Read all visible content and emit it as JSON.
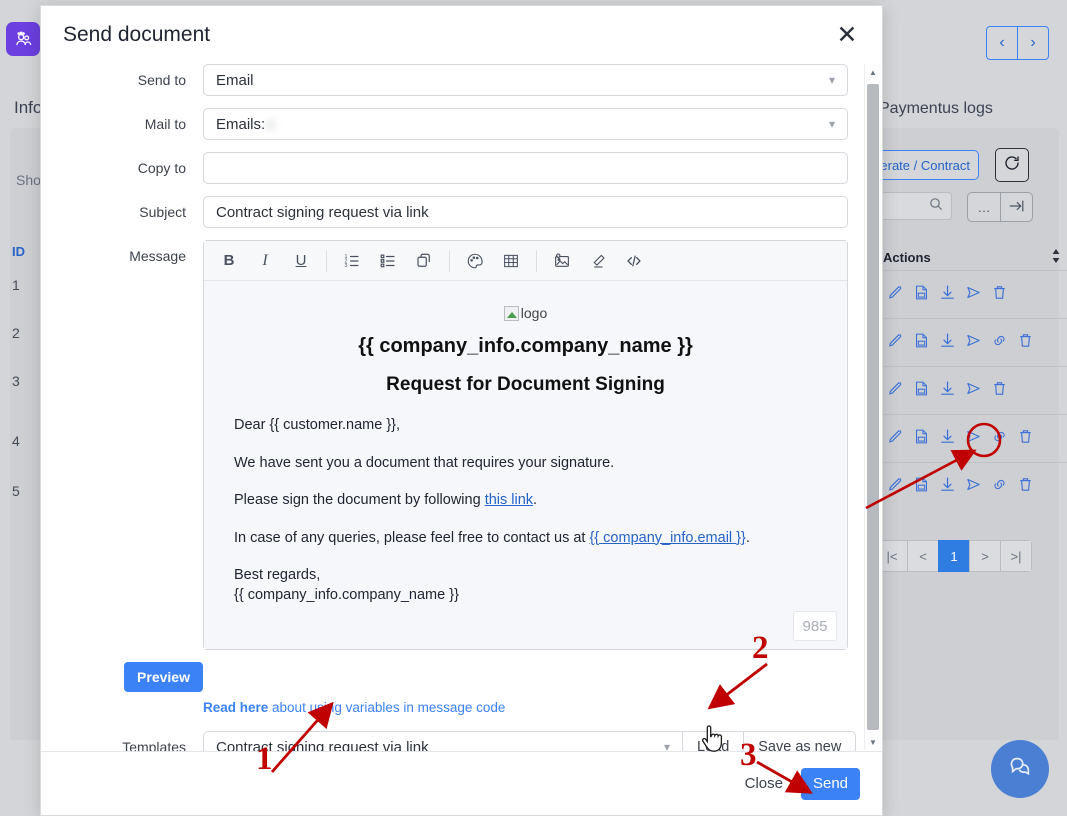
{
  "background": {
    "app_title": "Info",
    "panel_showing": "Sho",
    "id_column": "ID",
    "id_values": [
      "1",
      "2",
      "3",
      "4",
      "5"
    ],
    "right_panel_title": "Paymentus logs",
    "generate_button": "erate / Contract",
    "refresh_icon": "refresh-icon",
    "search_icon": "search-icon",
    "more_icon": "ellipsis-icon",
    "expand_icon": "expand-right-icon",
    "actions_column": "Actions",
    "sort_icon": "sort-icon",
    "row_actions": [
      [
        "edit-icon",
        "pdf-icon",
        "download-icon",
        "send-icon",
        "delete-icon"
      ],
      [
        "edit-icon",
        "pdf-icon",
        "download-icon",
        "send-icon",
        "link-icon",
        "delete-icon"
      ],
      [
        "edit-icon",
        "pdf-icon",
        "download-icon",
        "send-icon",
        "delete-icon"
      ],
      [
        "edit-icon",
        "pdf-icon",
        "download-icon",
        "send-icon",
        "link-icon",
        "delete-icon"
      ],
      [
        "edit-icon",
        "pdf-icon",
        "download-icon",
        "send-icon",
        "link-icon",
        "delete-icon"
      ]
    ],
    "pagination": {
      "first": "|<",
      "prev": "<",
      "current_page": "1",
      "next": ">",
      "last": ">|"
    },
    "topnav": {
      "prev": "‹",
      "next": "›"
    },
    "chat_icon": "chat-bubble-icon",
    "accent_blue": "#3b82f6",
    "brand_purple": "#6c3fe0"
  },
  "modal": {
    "title": "Send document",
    "close_label": "✕",
    "fields": {
      "send_to_label": "Send to",
      "send_to_value": "Email",
      "mail_to_label": "Mail to",
      "mail_to_prefix": "Emails:",
      "mail_to_value": "c",
      "copy_to_label": "Copy to",
      "copy_to_value": "",
      "copy_to_placeholder": "",
      "subject_label": "Subject",
      "subject_value": "Contract signing request via link",
      "message_label": "Message",
      "preview_button": "Preview"
    },
    "toolbar": [
      {
        "name": "bold-icon",
        "glyph": "B"
      },
      {
        "name": "italic-icon",
        "glyph": "I"
      },
      {
        "name": "underline-icon",
        "glyph": "U"
      },
      {
        "name": "ordered-list-icon",
        "glyph": ""
      },
      {
        "name": "bullet-list-icon",
        "glyph": ""
      },
      {
        "name": "copy-icon",
        "glyph": ""
      },
      {
        "name": "color-palette-icon",
        "glyph": ""
      },
      {
        "name": "table-icon",
        "glyph": ""
      },
      {
        "name": "insert-image-icon",
        "glyph": ""
      },
      {
        "name": "eraser-icon",
        "glyph": ""
      },
      {
        "name": "code-icon",
        "glyph": "</>"
      }
    ],
    "email_preview": {
      "logo_alt": "logo",
      "company_name": "{{ company_info.company_name }}",
      "heading": "Request for Document Signing",
      "greeting": "Dear {{ customer.name }},",
      "line1": "We have sent you a document that requires your signature.",
      "line2_before": "Please sign the document by following ",
      "line2_link": "this link",
      "line2_after": ".",
      "line3_before": "In case of any queries, please feel free to contact us at ",
      "line3_link": "{{ company_info.email }}",
      "line3_after": ".",
      "signoff": "Best regards,",
      "signoff_company": "{{ company_info.company_name }}",
      "char_count": "985"
    },
    "help_link_bold": "Read here",
    "help_link_rest": " about using variables in message code",
    "templates_label": "Templates",
    "templates_value": "Contract signing request via link",
    "load_button": "Load",
    "save_as_new_button": "Save as new",
    "close_button": "Close",
    "send_button": "Send"
  },
  "annotations": {
    "step1": "1",
    "step2": "2",
    "step3": "3"
  }
}
